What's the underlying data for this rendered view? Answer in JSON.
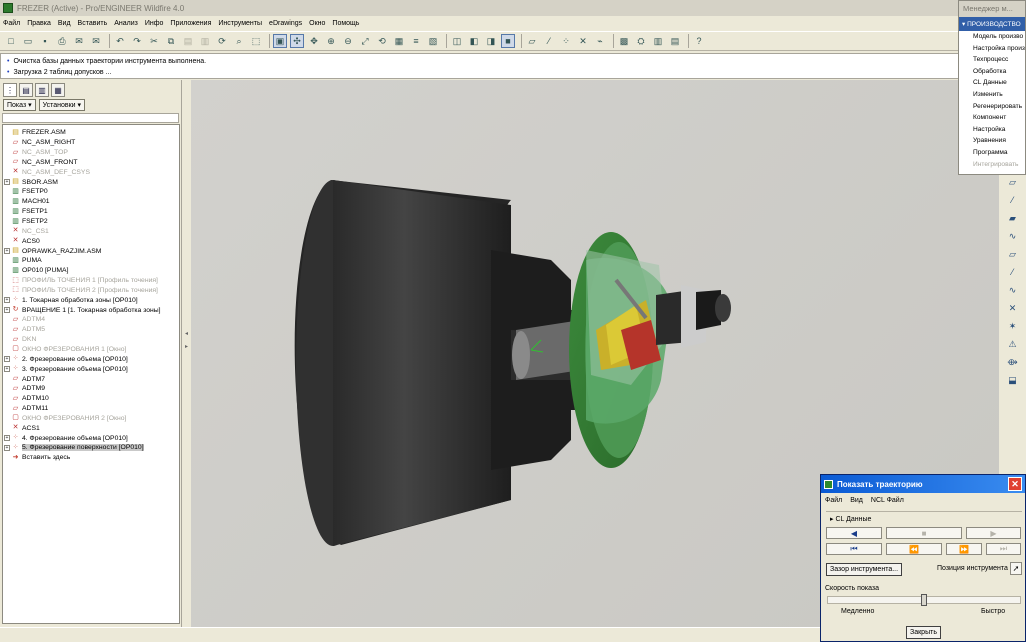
{
  "window": {
    "title": "FREZER (Active) - Pro/ENGINEER Wildfire 4.0"
  },
  "menu": [
    "Файл",
    "Правка",
    "Вид",
    "Вставить",
    "Анализ",
    "Инфо",
    "Приложения",
    "Инструменты",
    "eDrawings",
    "Окно",
    "Помощь"
  ],
  "messages": [
    "Очистка базы данных траектории инструмента выполнена.",
    "Загрузка 2 таблиц допусков ..."
  ],
  "left_panel": {
    "show_label": "Показ",
    "settings_label": "Установки"
  },
  "tree": [
    {
      "label": "FREZER.ASM",
      "icon": "assembly-icon",
      "ex": false,
      "dim": false
    },
    {
      "label": "NC_ASM_RIGHT",
      "icon": "datum-plane-icon",
      "ex": false,
      "dim": false
    },
    {
      "label": "NC_ASM_TOP",
      "icon": "datum-plane-icon",
      "ex": false,
      "dim": true
    },
    {
      "label": "NC_ASM_FRONT",
      "icon": "datum-plane-icon",
      "ex": false,
      "dim": false
    },
    {
      "label": "NC_ASM_DEF_CSYS",
      "icon": "csys-icon",
      "ex": false,
      "dim": true
    },
    {
      "label": "SBOR.ASM",
      "icon": "assembly-icon",
      "ex": true,
      "dim": false
    },
    {
      "label": "FSETP0",
      "icon": "part-icon",
      "ex": false,
      "dim": false
    },
    {
      "label": "MACH01",
      "icon": "part-icon",
      "ex": false,
      "dim": false
    },
    {
      "label": "FSETP1",
      "icon": "part-icon",
      "ex": false,
      "dim": false
    },
    {
      "label": "FSETP2",
      "icon": "part-icon",
      "ex": false,
      "dim": false
    },
    {
      "label": "NC_CS1",
      "icon": "csys-icon",
      "ex": false,
      "dim": true
    },
    {
      "label": "ACS0",
      "icon": "csys-icon",
      "ex": false,
      "dim": false
    },
    {
      "label": "OPRAWKA_RAZJIM.ASM",
      "icon": "assembly-icon",
      "ex": true,
      "dim": false
    },
    {
      "label": "PUMA",
      "icon": "part-icon",
      "ex": false,
      "dim": false
    },
    {
      "label": "OP010 [PUMA]",
      "icon": "part-icon",
      "ex": false,
      "dim": false
    },
    {
      "label": "ПРОФИЛЬ ТОЧЕНИЯ 1 [Профиль точения]",
      "icon": "profile-icon",
      "ex": false,
      "dim": true
    },
    {
      "label": "ПРОФИЛЬ ТОЧЕНИЯ 2 [Профиль точения]",
      "icon": "profile-icon",
      "ex": false,
      "dim": true
    },
    {
      "label": "1. Токарная обработка зоны [OP010]",
      "icon": "operation-icon",
      "ex": true,
      "dim": false
    },
    {
      "label": "ВРАЩЕНИЕ 1 [1. Токарная обработка зоны]",
      "icon": "rotation-icon",
      "ex": true,
      "dim": false
    },
    {
      "label": "ADTM4",
      "icon": "datum-plane-icon",
      "ex": false,
      "dim": true
    },
    {
      "label": "ADTM5",
      "icon": "datum-plane-icon",
      "ex": false,
      "dim": true
    },
    {
      "label": "DKN",
      "icon": "datum-plane-icon",
      "ex": false,
      "dim": true
    },
    {
      "label": "ОКНО ФРЕЗЕРОВАНИЯ 1 [Окно]",
      "icon": "window-icon",
      "ex": false,
      "dim": true
    },
    {
      "label": "2. Фрезерование объема [OP010]",
      "icon": "operation-icon",
      "ex": true,
      "dim": false
    },
    {
      "label": "3. Фрезерование объема [OP010]",
      "icon": "operation-icon",
      "ex": true,
      "dim": false
    },
    {
      "label": "ADTM7",
      "icon": "datum-plane-icon",
      "ex": false,
      "dim": false
    },
    {
      "label": "ADTM9",
      "icon": "datum-plane-icon",
      "ex": false,
      "dim": false
    },
    {
      "label": "ADTM10",
      "icon": "datum-plane-icon",
      "ex": false,
      "dim": false
    },
    {
      "label": "ADTM11",
      "icon": "datum-plane-icon",
      "ex": false,
      "dim": false
    },
    {
      "label": "ОКНО ФРЕЗЕРОВАНИЯ 2 [Окно]",
      "icon": "window-icon",
      "ex": false,
      "dim": true
    },
    {
      "label": "ACS1",
      "icon": "csys-icon",
      "ex": false,
      "dim": false
    },
    {
      "label": "4. Фрезерование объема [OP010]",
      "icon": "operation-icon",
      "ex": true,
      "dim": false
    },
    {
      "label": "5. Фрезерование поверхности [OP010]",
      "icon": "operation-icon",
      "ex": true,
      "dim": false,
      "sel": true
    },
    {
      "label": "Вставить здесь",
      "icon": "insert-here-icon",
      "ex": false,
      "dim": false
    }
  ],
  "menu_manager": {
    "title": "Менеджер м...",
    "group": "ПРОИЗВОДСТВО",
    "items": [
      "Модель произво",
      "Настройка произ",
      "Техпроцесс",
      "Обработка",
      "CL Данные",
      "Изменить",
      "Регенерировать",
      "Компонент",
      "Настройка",
      "Уравнения",
      "Программа",
      "Интегрировать"
    ],
    "disabled_index": 11
  },
  "dialog": {
    "title": "Показать траекторию",
    "menu": [
      "Файл",
      "Вид",
      "NCL Файл"
    ],
    "cl_section": "CL Данные",
    "tool_clearance_button": "Зазор инструмента...",
    "tool_position_label": "Позиция инструмента",
    "speed_label": "Скорость показа",
    "slow_label": "Медленно",
    "fast_label": "Быстро",
    "close_button": "Закрыть",
    "speed_value": 0.5
  }
}
